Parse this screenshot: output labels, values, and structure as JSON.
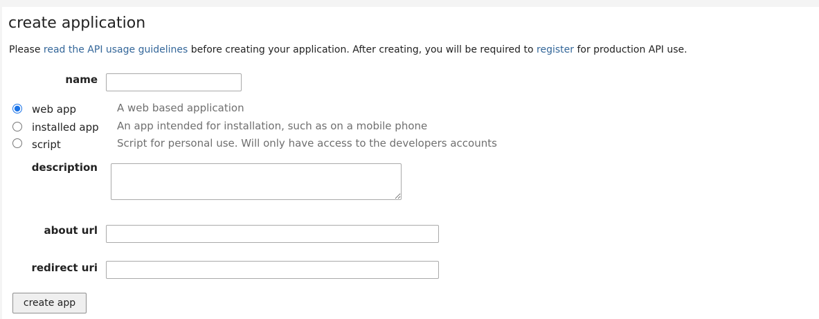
{
  "title": "create application",
  "intro": {
    "prefix": "Please ",
    "guidelines_link": "read the API usage guidelines",
    "middle": " before creating your application. After creating, you will be required to ",
    "register_link": "register",
    "suffix": " for production API use."
  },
  "form": {
    "name_label": "name",
    "name_value": "",
    "app_types": [
      {
        "label": "web app",
        "description": "A web based application",
        "selected": true
      },
      {
        "label": "installed app",
        "description": "An app intended for installation, such as on a mobile phone",
        "selected": false
      },
      {
        "label": "script",
        "description": "Script for personal use. Will only have access to the developers accounts",
        "selected": false
      }
    ],
    "description_label": "description",
    "description_value": "",
    "about_url_label": "about url",
    "about_url_value": "",
    "redirect_uri_label": "redirect uri",
    "redirect_uri_value": "",
    "submit_label": "create app"
  },
  "colors": {
    "link": "#336699",
    "radio_selected": "#1a73e8",
    "secondary_text": "#6f6f6f"
  }
}
